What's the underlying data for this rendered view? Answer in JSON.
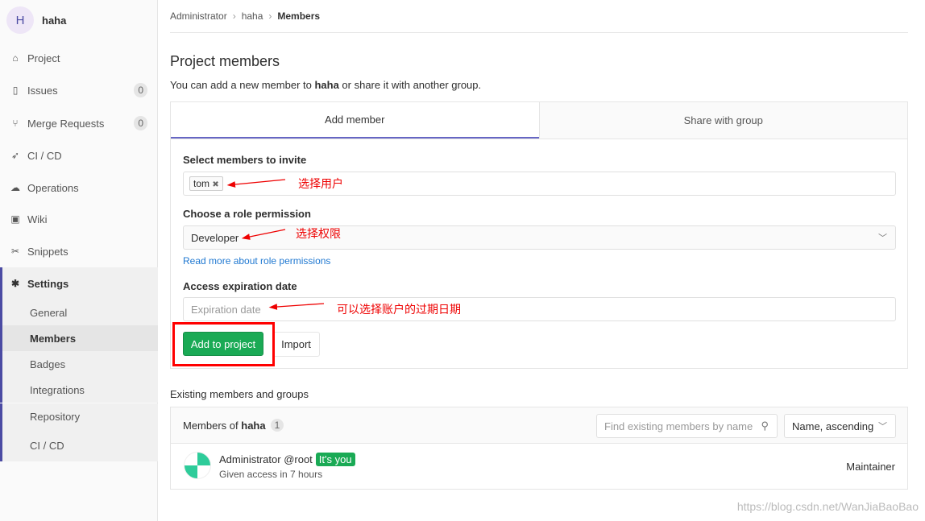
{
  "sidebar": {
    "avatar_letter": "H",
    "project_name": "haha",
    "items": [
      {
        "label": "Project",
        "icon": "home-icon"
      },
      {
        "label": "Issues",
        "icon": "issues-icon",
        "count": "0"
      },
      {
        "label": "Merge Requests",
        "icon": "merge-request-icon",
        "count": "0"
      },
      {
        "label": "CI / CD",
        "icon": "rocket-icon"
      },
      {
        "label": "Operations",
        "icon": "cloud-gear-icon"
      },
      {
        "label": "Wiki",
        "icon": "book-icon"
      },
      {
        "label": "Snippets",
        "icon": "scissors-icon"
      },
      {
        "label": "Settings",
        "icon": "gear-icon"
      }
    ],
    "sub_items": [
      "General",
      "Members",
      "Badges",
      "Integrations",
      "Repository",
      "CI / CD"
    ]
  },
  "breadcrumb": [
    "Administrator",
    "haha",
    "Members"
  ],
  "title": "Project members",
  "desc": {
    "pre": "You can add a new member to ",
    "project": "haha",
    "post": " or share it with another group."
  },
  "tabs": [
    "Add member",
    "Share with group"
  ],
  "form": {
    "invite_label": "Select members to invite",
    "token": "tom",
    "role_label": "Choose a role permission",
    "role_value": "Developer",
    "role_link": "Read more about role permissions",
    "exp_label": "Access expiration date",
    "exp_placeholder": "Expiration date",
    "add_button": "Add to project",
    "import_button": "Import"
  },
  "annotations": [
    "选择用户",
    "选择权限",
    "可以选择账户的过期日期"
  ],
  "existing": {
    "title": "Existing members and groups",
    "members_of": "Members of ",
    "project": "haha",
    "count": "1",
    "search_placeholder": "Find existing members by name",
    "sort": "Name, ascending",
    "members": [
      {
        "name": "Administrator @root",
        "badge": "It's you",
        "desc": "Given access in 7 hours",
        "role": "Maintainer"
      }
    ]
  },
  "watermark": "https://blog.csdn.net/WanJiaBaoBao"
}
